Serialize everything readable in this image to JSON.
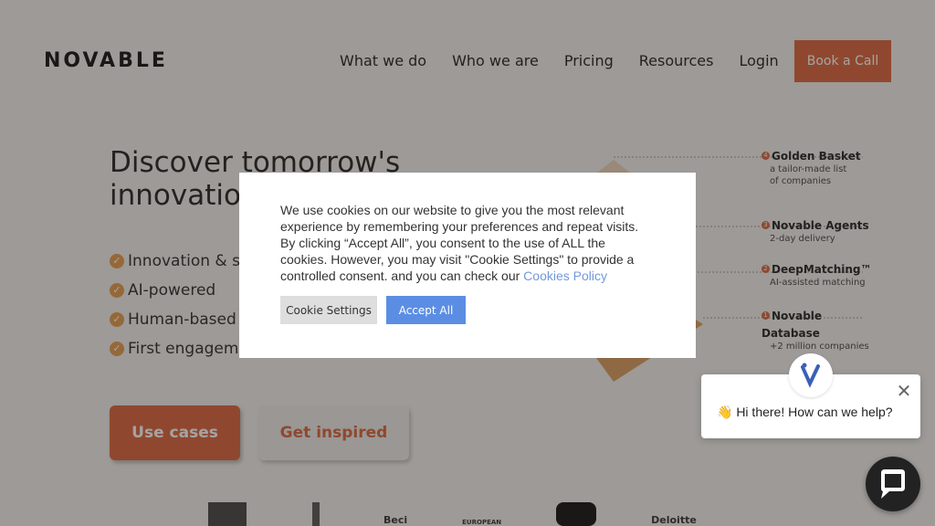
{
  "brand": {
    "logo": "NOVABLE"
  },
  "nav": [
    "What we do",
    "Who we are",
    "Pricing",
    "Resources",
    "Login"
  ],
  "header": {
    "cta": "Book a Call"
  },
  "hero": {
    "title": "Discover tomorrow's innovation",
    "bullets": [
      "Innovation & sta",
      "AI-powered",
      "Human-based v",
      "First engageme"
    ],
    "primary_button": "Use cases",
    "secondary_button": "Get inspired"
  },
  "funnel": [
    {
      "num": "4",
      "name": "Golden Basket",
      "sub": [
        "a tailor-made list",
        "of companies"
      ]
    },
    {
      "num": "3",
      "name": "Novable Agents",
      "sub": [
        "2-day delivery"
      ]
    },
    {
      "num": "2",
      "name": "DeepMatching™",
      "sub": [
        "AI-assisted matching"
      ]
    },
    {
      "num": "1",
      "name": "Novable Database",
      "sub": [
        "+2 million companies"
      ]
    }
  ],
  "logos": [
    "Beci",
    "EUROPEAN",
    "Deloitte"
  ],
  "cookie": {
    "text": "We use cookies on our website to give you the most relevant experience by remembering your preferences and repeat visits. By clicking “Accept All”, you consent to the use of ALL the cookies. However, you may visit \"Cookie Settings\" to provide a controlled consent. and you can check our",
    "policy_link": "Cookies Policy",
    "settings_button": "Cookie Settings",
    "accept_button": "Accept All"
  },
  "chat": {
    "message": "👋 Hi there! How can we help?",
    "close": "✕"
  },
  "colors": {
    "accent": "#d9623b",
    "cookie_accept": "#5b8ee3",
    "link": "#7398dd"
  }
}
